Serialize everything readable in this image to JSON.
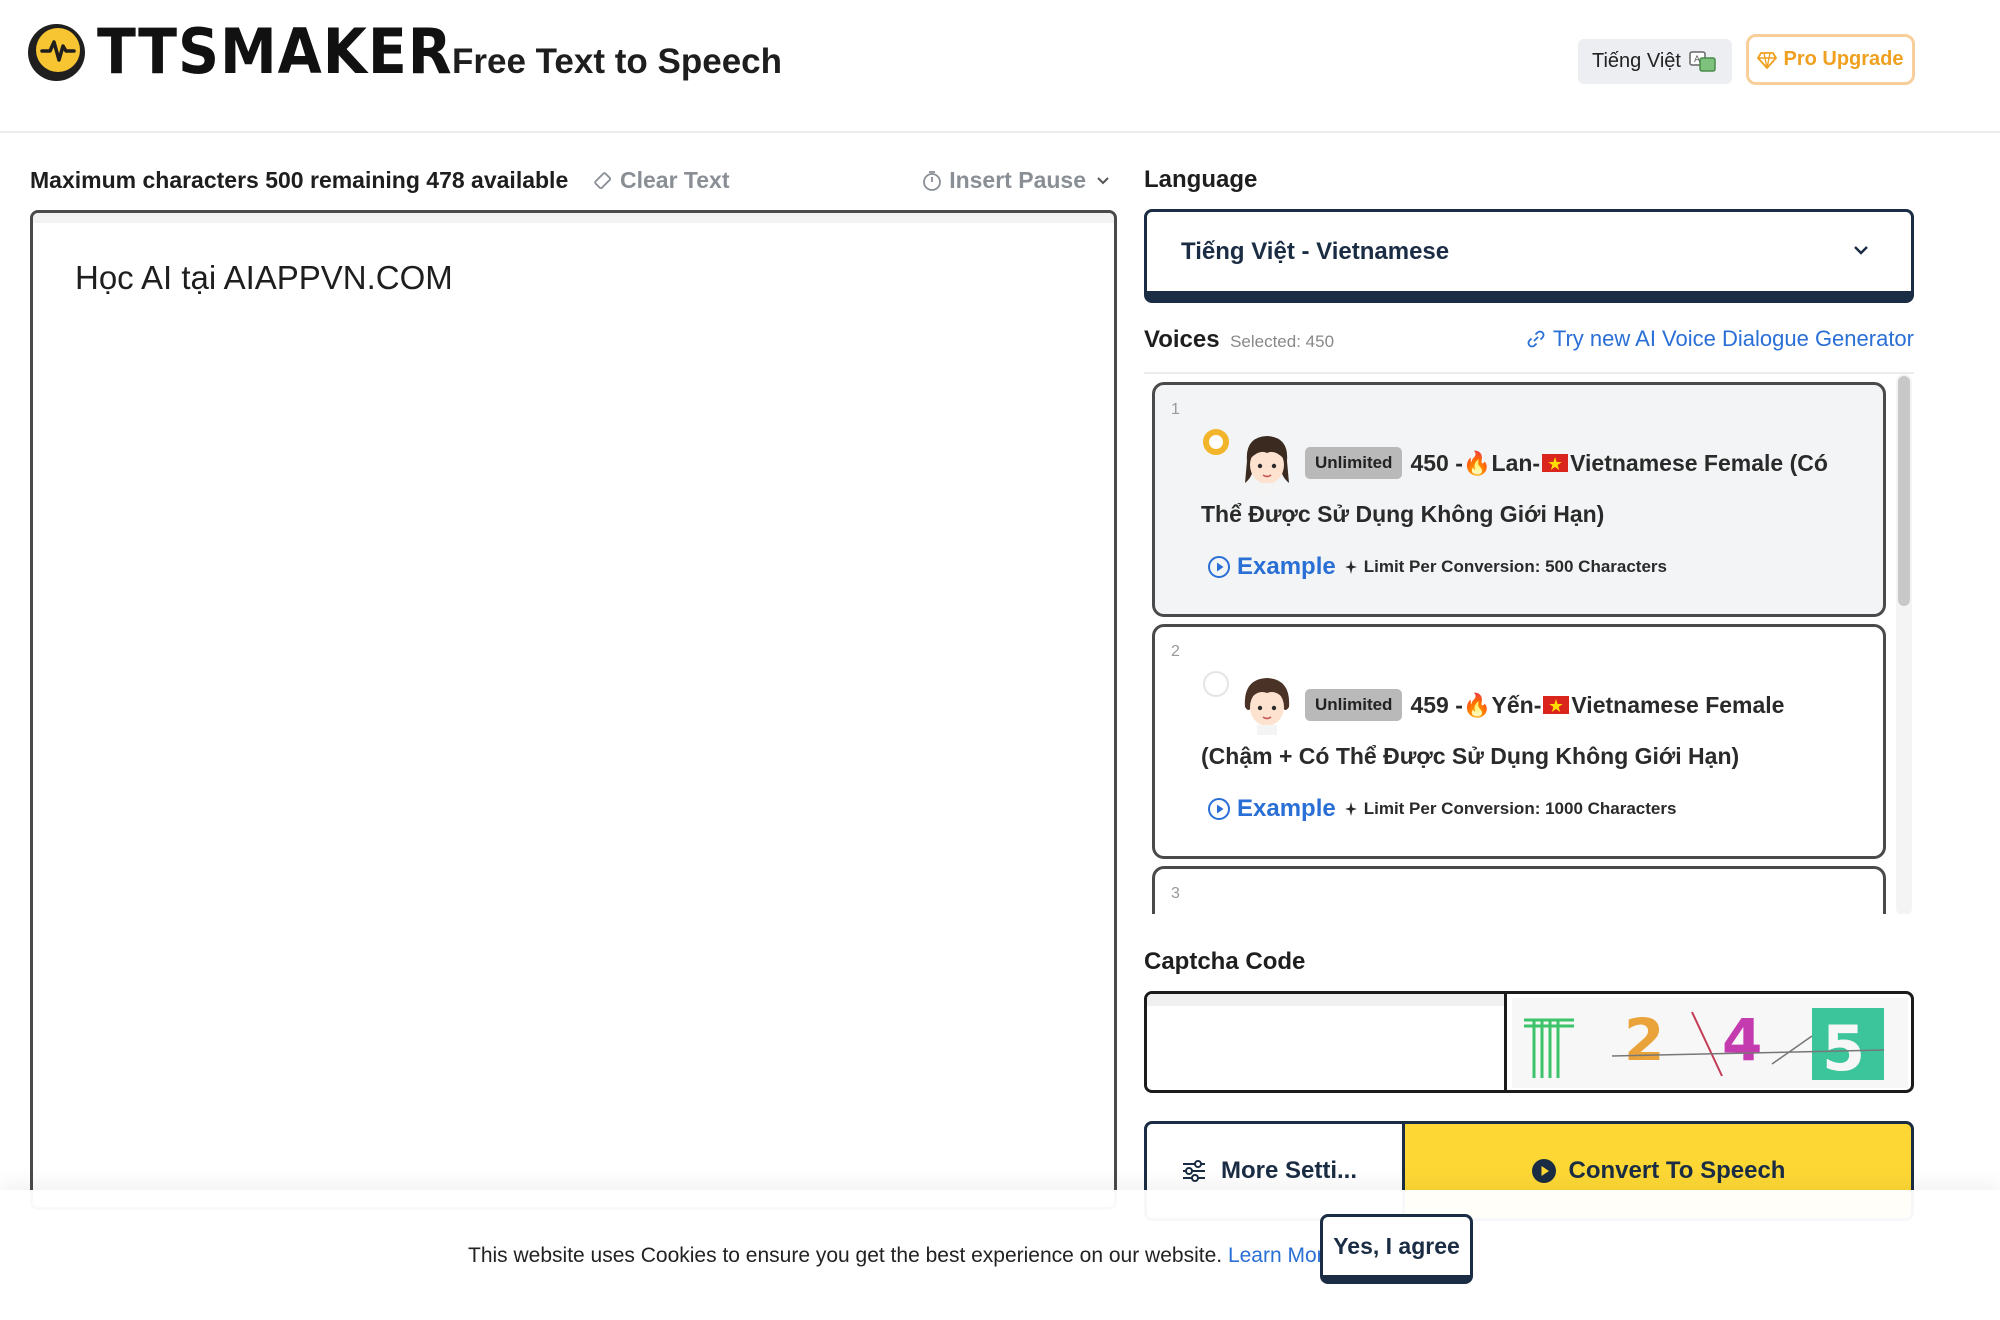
{
  "header": {
    "logo_text": "TTSMAKER",
    "tagline": "Free Text to Speech",
    "language_switch": "Tiếng Việt",
    "pro_upgrade": "Pro Upgrade"
  },
  "editor": {
    "counter": "Maximum characters 500 remaining 478 available",
    "clear_text": "Clear Text",
    "insert_pause": "Insert Pause",
    "content": "Học AI tại AIAPPVN.COM"
  },
  "language": {
    "label": "Language",
    "selected": "Tiếng Việt - Vietnamese"
  },
  "voices": {
    "label": "Voices",
    "selected_info": "Selected: 450",
    "dialogue_link": "Try new AI Voice Dialogue Generator",
    "items": [
      {
        "index": "1",
        "badge": "Unlimited",
        "line1_prefix": "450 - ",
        "name": "Lan-",
        "line1_suffix": " Vietnamese Female (Có",
        "line2": "Thể Được Sử Dụng Không Giới Hạn)",
        "example": "Example",
        "limit": "Limit Per Conversion: 500 Characters",
        "selected": true
      },
      {
        "index": "2",
        "badge": "Unlimited",
        "line1_prefix": "459 - ",
        "name": "Yến-",
        "line1_suffix": " Vietnamese Female",
        "line2": "(Chậm + Có Thể Được Sử Dụng Không Giới Hạn)",
        "example": "Example",
        "limit": "Limit Per Conversion: 1000 Characters",
        "selected": false
      },
      {
        "index": "3"
      }
    ]
  },
  "captcha": {
    "label": "Captcha Code",
    "code_text": "2345"
  },
  "actions": {
    "more_settings": "More Setti...",
    "convert": "Convert To Speech"
  },
  "cookie": {
    "message": "This website uses Cookies to ensure you get the best experience on our website.",
    "learn_more": "Learn More",
    "agree": "Yes, I agree"
  },
  "colors": {
    "accent_yellow": "#fdd835",
    "navy": "#1b2d44",
    "link_blue": "#2a6fd6",
    "radio_orange": "#f2b42a"
  }
}
